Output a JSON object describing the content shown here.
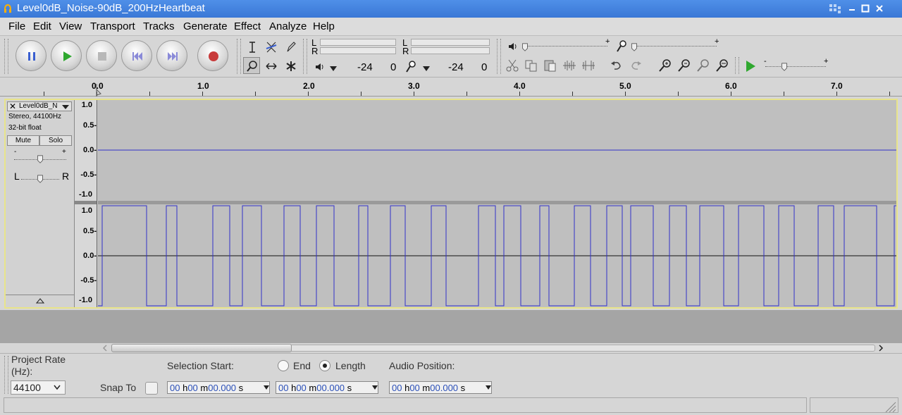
{
  "window": {
    "title": "Level0dB_Noise-90dB_200HzHeartbeat"
  },
  "menu": [
    "File",
    "Edit",
    "View",
    "Transport",
    "Tracks",
    "Generate",
    "Effect",
    "Analyze",
    "Help"
  ],
  "meters": {
    "play_L": "L",
    "play_R": "R",
    "rec_L": "L",
    "rec_R": "R",
    "play_db": "-24",
    "play_zero": "0",
    "rec_db": "-24",
    "rec_zero": "0"
  },
  "sliders": {
    "minus": "-",
    "plus": "+"
  },
  "ruler": {
    "labels": [
      "0.0",
      "1.0",
      "2.0",
      "3.0",
      "4.0",
      "5.0",
      "6.0",
      "7.0"
    ]
  },
  "track": {
    "name": "Level0dB_N",
    "rate": "Stereo, 44100Hz",
    "format": "32-bit float",
    "mute": "Mute",
    "solo": "Solo",
    "gain_minus": "-",
    "gain_plus": "+",
    "pan_L": "L",
    "pan_R": "R",
    "scale": [
      "1.0",
      "0.5-",
      "0.0-",
      "-0.5-",
      "-1.0"
    ]
  },
  "selection": {
    "project_rate_label": "Project Rate (Hz):",
    "project_rate": "44100",
    "snap_to": "Snap To",
    "selection_start_label": "Selection Start:",
    "end_label": "End",
    "length_label": "Length",
    "audio_position_label": "Audio Position:",
    "time_units": {
      "h": "h",
      "m": "m",
      "s": "s"
    },
    "start": {
      "hh": "00",
      "mm": "00",
      "ss": "00.000"
    },
    "length": {
      "hh": "00",
      "mm": "00",
      "ss": "00.000"
    },
    "position": {
      "hh": "00",
      "mm": "00",
      "ss": "00.000"
    },
    "length_selected": true,
    "snap_checked": false
  },
  "colors": {
    "title_bar": "#3a78d6",
    "wave": "#3232c8",
    "track_focus": "#e8e48a",
    "record": "#c83a3a",
    "play": "#2fa82f"
  }
}
